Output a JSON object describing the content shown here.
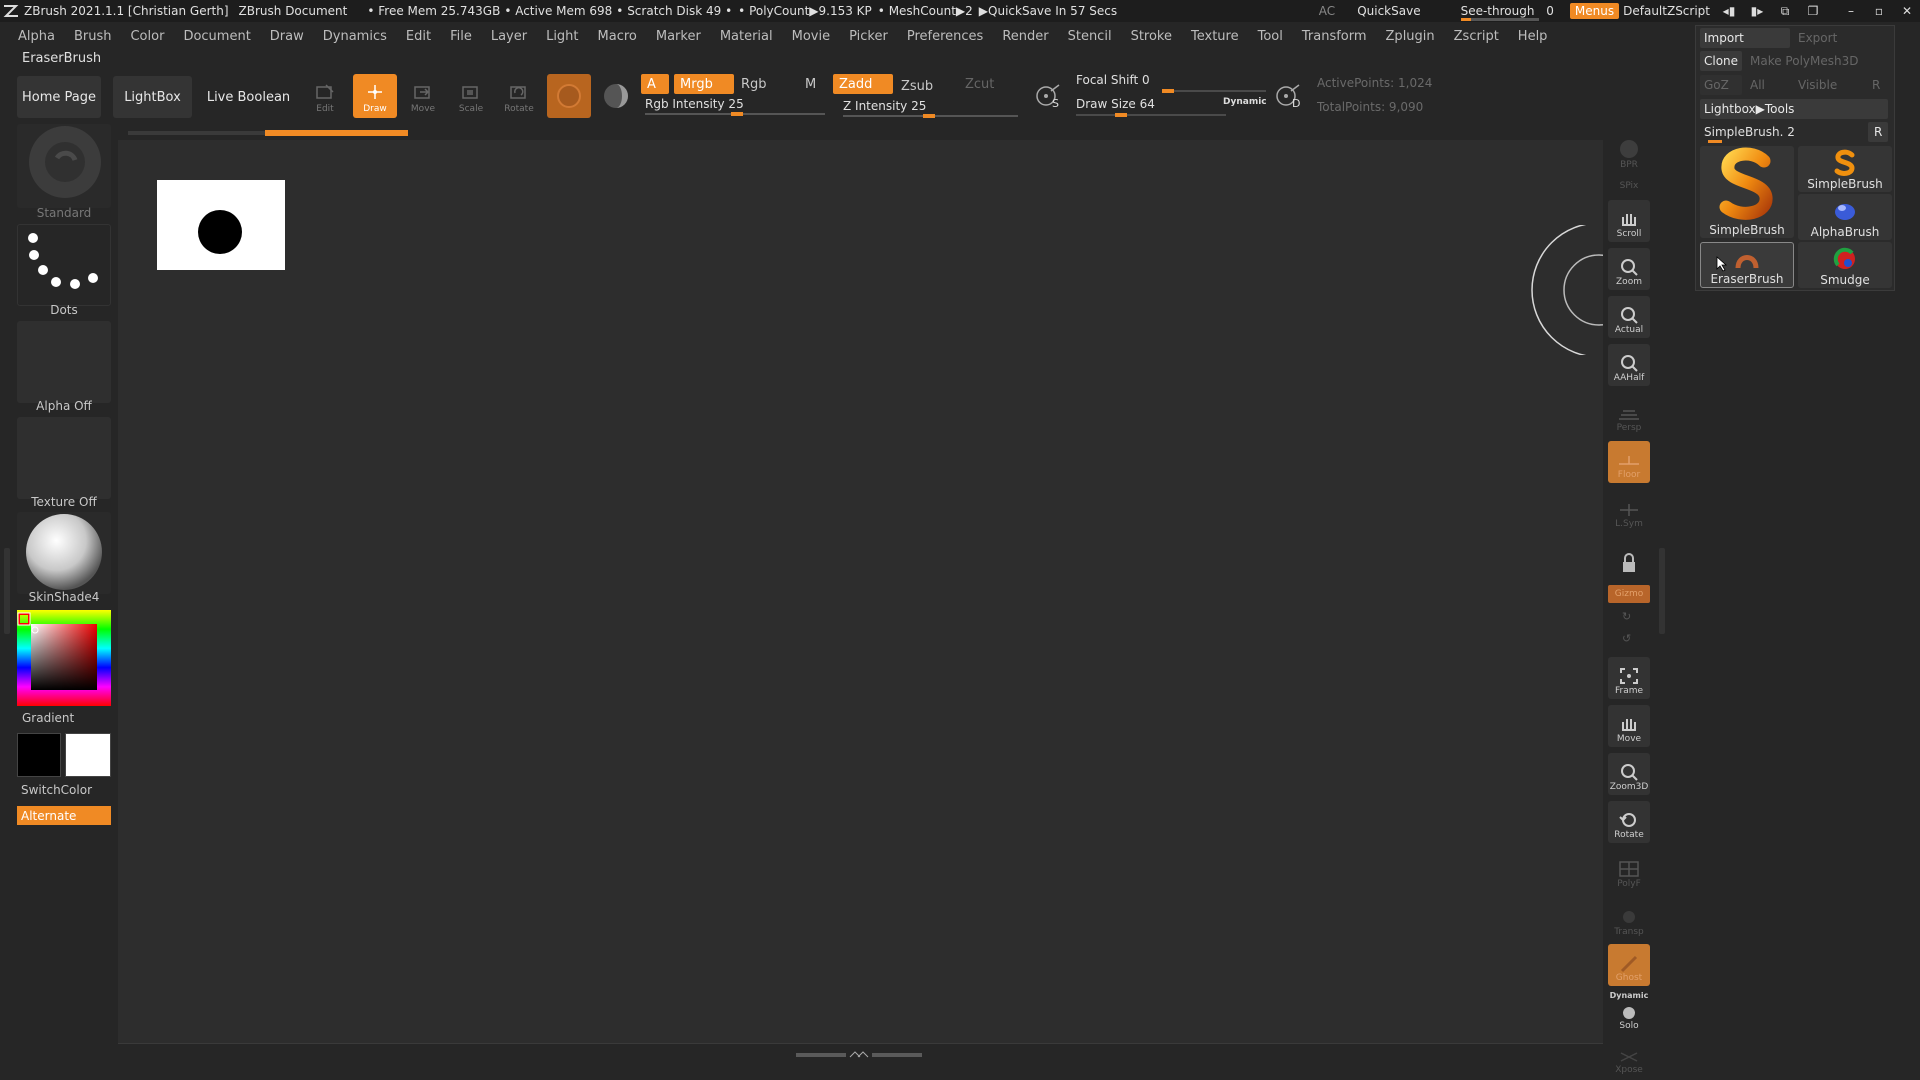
{
  "titlebar": {
    "app": "ZBrush 2021.1.1 [Christian Gerth]",
    "document": "ZBrush Document",
    "free_mem": "• Free Mem 25.743GB",
    "active_mem": "• Active Mem 698",
    "scratch": "• Scratch Disk 49 •",
    "polycount": "• PolyCount▶9.153 KP",
    "meshcount": "• MeshCount▶2",
    "quicksave_timer": "▶QuickSave In 57 Secs",
    "ac": "AC",
    "quicksave": "QuickSave",
    "seethrough": "See-through",
    "seethrough_value": "0",
    "menus": "Menus",
    "script": "DefaultZScript"
  },
  "menubar": [
    "Alpha",
    "Brush",
    "Color",
    "Document",
    "Draw",
    "Dynamics",
    "Edit",
    "File",
    "Layer",
    "Light",
    "Macro",
    "Marker",
    "Material",
    "Movie",
    "Picker",
    "Preferences",
    "Render",
    "Stencil",
    "Stroke",
    "Texture",
    "Tool",
    "Transform",
    "Zplugin",
    "Zscript",
    "Help"
  ],
  "current_brush": "EraserBrush",
  "toolbar": {
    "home": "Home Page",
    "lightbox": "LightBox",
    "live_boolean": "Live Boolean",
    "edit": "Edit",
    "draw": "Draw",
    "move": "Move",
    "scale": "Scale",
    "rotate": "Rotate",
    "a": "A",
    "mrgb": "Mrgb",
    "rgb": "Rgb",
    "m": "M",
    "zadd": "Zadd",
    "zsub": "Zsub",
    "zcut": "Zcut",
    "rgb_intensity": "Rgb Intensity 25",
    "z_intensity": "Z Intensity 25",
    "focal_shift": "Focal Shift 0",
    "draw_size": "Draw Size 64",
    "dynamic": "Dynamic",
    "s": "S",
    "d": "D",
    "active_points": "ActivePoints: 1,024",
    "total_points": "TotalPoints: 9,090"
  },
  "left_shelf": {
    "brush": "Standard",
    "stroke": "Dots",
    "alpha": "Alpha Off",
    "texture": "Texture Off",
    "material": "SkinShade4",
    "gradient": "Gradient",
    "switch_color": "SwitchColor",
    "alternate": "Alternate"
  },
  "right_shelf": [
    "BPR",
    "SPix",
    "Scroll",
    "Zoom",
    "Actual",
    "AAHalf",
    "Persp",
    "Floor",
    "L.Sym",
    "",
    "Gizmo",
    "",
    "",
    "Frame",
    "Move",
    "Zoom3D",
    "Rotate",
    "PolyF",
    "Transp",
    "Ghost",
    "Solo",
    "Xpose"
  ],
  "right_shelf_dynamic": "Dynamic",
  "tool_panel": {
    "import": "Import",
    "export": "Export",
    "clone": "Clone",
    "make_polymesh": "Make PolyMesh3D",
    "goz": "GoZ",
    "all": "All",
    "visible": "Visible",
    "r": "R",
    "lightbox_tools": "Lightbox▶Tools",
    "current_tool": "SimpleBrush. 2",
    "tiles": [
      "SimpleBrush",
      "SimpleBrush",
      "AlphaBrush",
      "EraserBrush",
      "Smudge"
    ]
  },
  "colors": {
    "accent": "#f08a24",
    "bg": "#262626",
    "canvas": "#2d2d2d"
  }
}
